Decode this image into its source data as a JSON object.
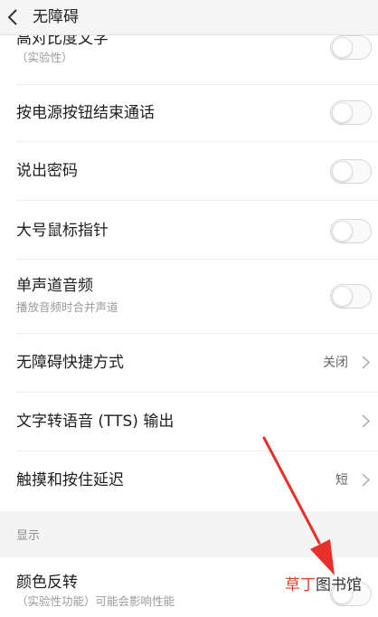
{
  "header": {
    "title": "无障碍",
    "back_icon": "chevron-left-icon"
  },
  "items": [
    {
      "label": "高对比度文字",
      "sub": "（实验性）",
      "control": "toggle",
      "on": false
    },
    {
      "label": "按电源按钮结束通话",
      "control": "toggle",
      "on": false
    },
    {
      "label": "说出密码",
      "control": "toggle",
      "on": false
    },
    {
      "label": "大号鼠标指针",
      "control": "toggle",
      "on": false
    },
    {
      "label": "单声道音频",
      "sub": "播放音频时合并声道",
      "control": "toggle",
      "on": false
    },
    {
      "label": "无障碍快捷方式",
      "value": "关闭",
      "control": "chevron"
    },
    {
      "label": "文字转语音 (TTS) 输出",
      "control": "chevron"
    },
    {
      "label": "触摸和按住延迟",
      "value": "短",
      "control": "chevron"
    }
  ],
  "section": {
    "title": "显示"
  },
  "display_items": [
    {
      "label": "颜色反转",
      "sub": "（实验性功能）可能会影响性能",
      "control": "toggle",
      "on": false
    }
  ],
  "annotation": {
    "arrow_color": "#e8302a",
    "arrow_icon": "red-arrow-icon"
  },
  "watermark": {
    "part1": "草丁",
    "part2": "图书馆"
  },
  "colors": {
    "toggle_off_border": "#d6d6d6",
    "section_bg": "#f4f4f4",
    "arrow_red": "#e8302a"
  }
}
